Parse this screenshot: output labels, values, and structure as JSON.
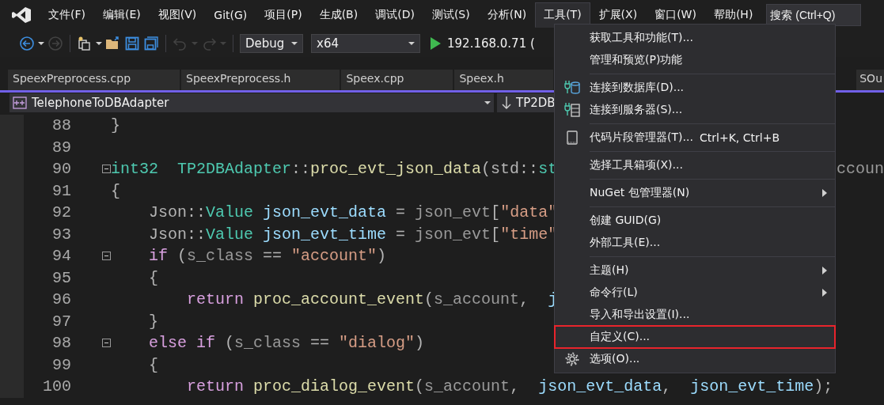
{
  "menu_bar": {
    "items": [
      {
        "label": "文件(F)",
        "selected": false
      },
      {
        "label": "编辑(E)",
        "selected": false
      },
      {
        "label": "视图(V)",
        "selected": false
      },
      {
        "label": "Git(G)",
        "selected": false
      },
      {
        "label": "项目(P)",
        "selected": false
      },
      {
        "label": "生成(B)",
        "selected": false
      },
      {
        "label": "调试(D)",
        "selected": false
      },
      {
        "label": "测试(S)",
        "selected": false
      },
      {
        "label": "分析(N)",
        "selected": false
      },
      {
        "label": "工具(T)",
        "selected": true
      },
      {
        "label": "扩展(X)",
        "selected": false
      },
      {
        "label": "窗口(W)",
        "selected": false
      },
      {
        "label": "帮助(H)",
        "selected": false
      }
    ],
    "search": {
      "placeholder": "搜索 (Ctrl+Q)"
    }
  },
  "toolbar": {
    "items": [
      {
        "kind": "back",
        "disabled": false
      },
      {
        "kind": "caret",
        "disabled": false
      },
      {
        "kind": "forward",
        "disabled": true
      },
      {
        "kind": "sep"
      },
      {
        "kind": "new-project",
        "disabled": false
      },
      {
        "kind": "caret",
        "disabled": false
      },
      {
        "kind": "open",
        "disabled": false
      },
      {
        "kind": "save",
        "disabled": false
      },
      {
        "kind": "save-all",
        "disabled": false
      },
      {
        "kind": "sep"
      },
      {
        "kind": "undo",
        "disabled": true
      },
      {
        "kind": "caret",
        "disabled": true
      },
      {
        "kind": "redo",
        "disabled": true
      },
      {
        "kind": "caret",
        "disabled": true
      },
      {
        "kind": "sep"
      }
    ],
    "configuration": "Debug",
    "platform": "x64",
    "run_target": "192.168.0.71 ("
  },
  "tabs": [
    {
      "label": "SpeexPreprocess.cpp",
      "selected": false
    },
    {
      "label": "SpeexPreprocess.h",
      "selected": false
    },
    {
      "label": "Speex.cpp",
      "selected": false
    },
    {
      "label": "Speex.h",
      "selected": false
    },
    {
      "label": "SOu",
      "selected": false
    }
  ],
  "nav_bar": {
    "scope": "TelephoneToDBAdapter",
    "member": "TP2DB"
  },
  "code": [
    {
      "number": "88",
      "fold": false,
      "tokens": [
        {
          "kind": "plain",
          "text": "}"
        }
      ]
    },
    {
      "number": "89",
      "fold": false
    },
    {
      "number": "90",
      "fold": true,
      "tokens": [
        {
          "kind": "type",
          "text": "int32"
        },
        {
          "kind": "type",
          "text": "  TP2DBAdapter"
        },
        {
          "kind": "plain",
          "text": "::"
        },
        {
          "kind": "fn",
          "text": "proc_evt_json_data"
        },
        {
          "kind": "plain",
          "text": "(std::"
        },
        {
          "kind": "type",
          "text": "st"
        }
      ],
      "tail": [
        {
          "kind": "param",
          "text": "ccoun"
        }
      ]
    },
    {
      "number": "91",
      "fold": false,
      "tokens": [
        {
          "kind": "plain",
          "text": "{"
        }
      ]
    },
    {
      "number": "92",
      "fold": false,
      "tokens": [
        {
          "kind": "plain",
          "text": "    Json::"
        },
        {
          "kind": "type",
          "text": "Value"
        },
        {
          "kind": "var",
          "text": " json_evt_data"
        },
        {
          "kind": "plain",
          "text": " = "
        },
        {
          "kind": "param",
          "text": "json_evt"
        },
        {
          "kind": "plain",
          "text": "["
        },
        {
          "kind": "str",
          "text": "\"data\""
        }
      ]
    },
    {
      "number": "93",
      "fold": false,
      "tokens": [
        {
          "kind": "plain",
          "text": "    Json::"
        },
        {
          "kind": "type",
          "text": "Value"
        },
        {
          "kind": "var",
          "text": " json_evt_time"
        },
        {
          "kind": "plain",
          "text": " = "
        },
        {
          "kind": "param",
          "text": "json_evt"
        },
        {
          "kind": "plain",
          "text": "["
        },
        {
          "kind": "str",
          "text": "\"time\""
        }
      ]
    },
    {
      "number": "94",
      "fold": true,
      "tokens": [
        {
          "kind": "kw",
          "text": "    if"
        },
        {
          "kind": "plain",
          "text": " ("
        },
        {
          "kind": "param",
          "text": "s_class"
        },
        {
          "kind": "plain",
          "text": " == "
        },
        {
          "kind": "str",
          "text": "\"account\""
        },
        {
          "kind": "plain",
          "text": ")"
        }
      ]
    },
    {
      "number": "95",
      "fold": false,
      "tokens": [
        {
          "kind": "plain",
          "text": "    {"
        }
      ]
    },
    {
      "number": "96",
      "fold": false,
      "tokens": [
        {
          "kind": "kw",
          "text": "        return"
        },
        {
          "kind": "fn",
          "text": " proc_account_event"
        },
        {
          "kind": "plain",
          "text": "("
        },
        {
          "kind": "param",
          "text": "s_account"
        },
        {
          "kind": "plain",
          "text": ",  "
        },
        {
          "kind": "var",
          "text": "j"
        }
      ]
    },
    {
      "number": "97",
      "fold": false,
      "tokens": [
        {
          "kind": "plain",
          "text": "    }"
        }
      ]
    },
    {
      "number": "98",
      "fold": true,
      "tokens": [
        {
          "kind": "kw",
          "text": "    else if"
        },
        {
          "kind": "plain",
          "text": " ("
        },
        {
          "kind": "param",
          "text": "s_class"
        },
        {
          "kind": "plain",
          "text": " == "
        },
        {
          "kind": "str",
          "text": "\"dialog\""
        },
        {
          "kind": "plain",
          "text": ")"
        }
      ]
    },
    {
      "number": "99",
      "fold": false,
      "tokens": [
        {
          "kind": "plain",
          "text": "    {"
        }
      ]
    },
    {
      "number": "100",
      "fold": false,
      "tokens": [
        {
          "kind": "kw",
          "text": "        return"
        },
        {
          "kind": "fn",
          "text": " proc_dialog_event"
        },
        {
          "kind": "plain",
          "text": "("
        },
        {
          "kind": "param",
          "text": "s_account"
        },
        {
          "kind": "plain",
          "text": ",  "
        },
        {
          "kind": "var",
          "text": "json_evt_data"
        },
        {
          "kind": "plain",
          "text": ",  "
        },
        {
          "kind": "var",
          "text": "json_evt_time"
        },
        {
          "kind": "plain",
          "text": ");"
        }
      ]
    }
  ],
  "tools_menu": {
    "items": [
      {
        "kind": "item",
        "label": "获取工具和功能(T)...",
        "marked": false
      },
      {
        "kind": "item",
        "label": "管理和预览(P)功能",
        "marked": false
      },
      {
        "kind": "separator"
      },
      {
        "kind": "database",
        "label": "连接到数据库(D)...",
        "marked": false
      },
      {
        "kind": "server",
        "label": "连接到服务器(S)...",
        "marked": false
      },
      {
        "kind": "separator"
      },
      {
        "kind": "snippet",
        "label": "代码片段管理器(T)...",
        "shortcut": "Ctrl+K, Ctrl+B",
        "marked": false
      },
      {
        "kind": "separator"
      },
      {
        "kind": "item",
        "label": "选择工具箱项(X)...",
        "marked": false
      },
      {
        "kind": "separator"
      },
      {
        "kind": "item",
        "label": "NuGet 包管理器(N)",
        "submenu": true,
        "marked": false
      },
      {
        "kind": "separator"
      },
      {
        "kind": "item",
        "label": "创建 GUID(G)",
        "marked": false
      },
      {
        "kind": "item",
        "label": "外部工具(E)...",
        "marked": false
      },
      {
        "kind": "separator"
      },
      {
        "kind": "item",
        "label": "主题(H)",
        "submenu": true,
        "marked": false
      },
      {
        "kind": "item",
        "label": "命令行(L)",
        "submenu": true,
        "marked": false
      },
      {
        "kind": "item",
        "label": "导入和导出设置(I)...",
        "marked": false
      },
      {
        "kind": "item",
        "label": "自定义(C)...",
        "marked": true
      },
      {
        "kind": "settings",
        "label": "选项(O)...",
        "marked": false
      }
    ]
  }
}
